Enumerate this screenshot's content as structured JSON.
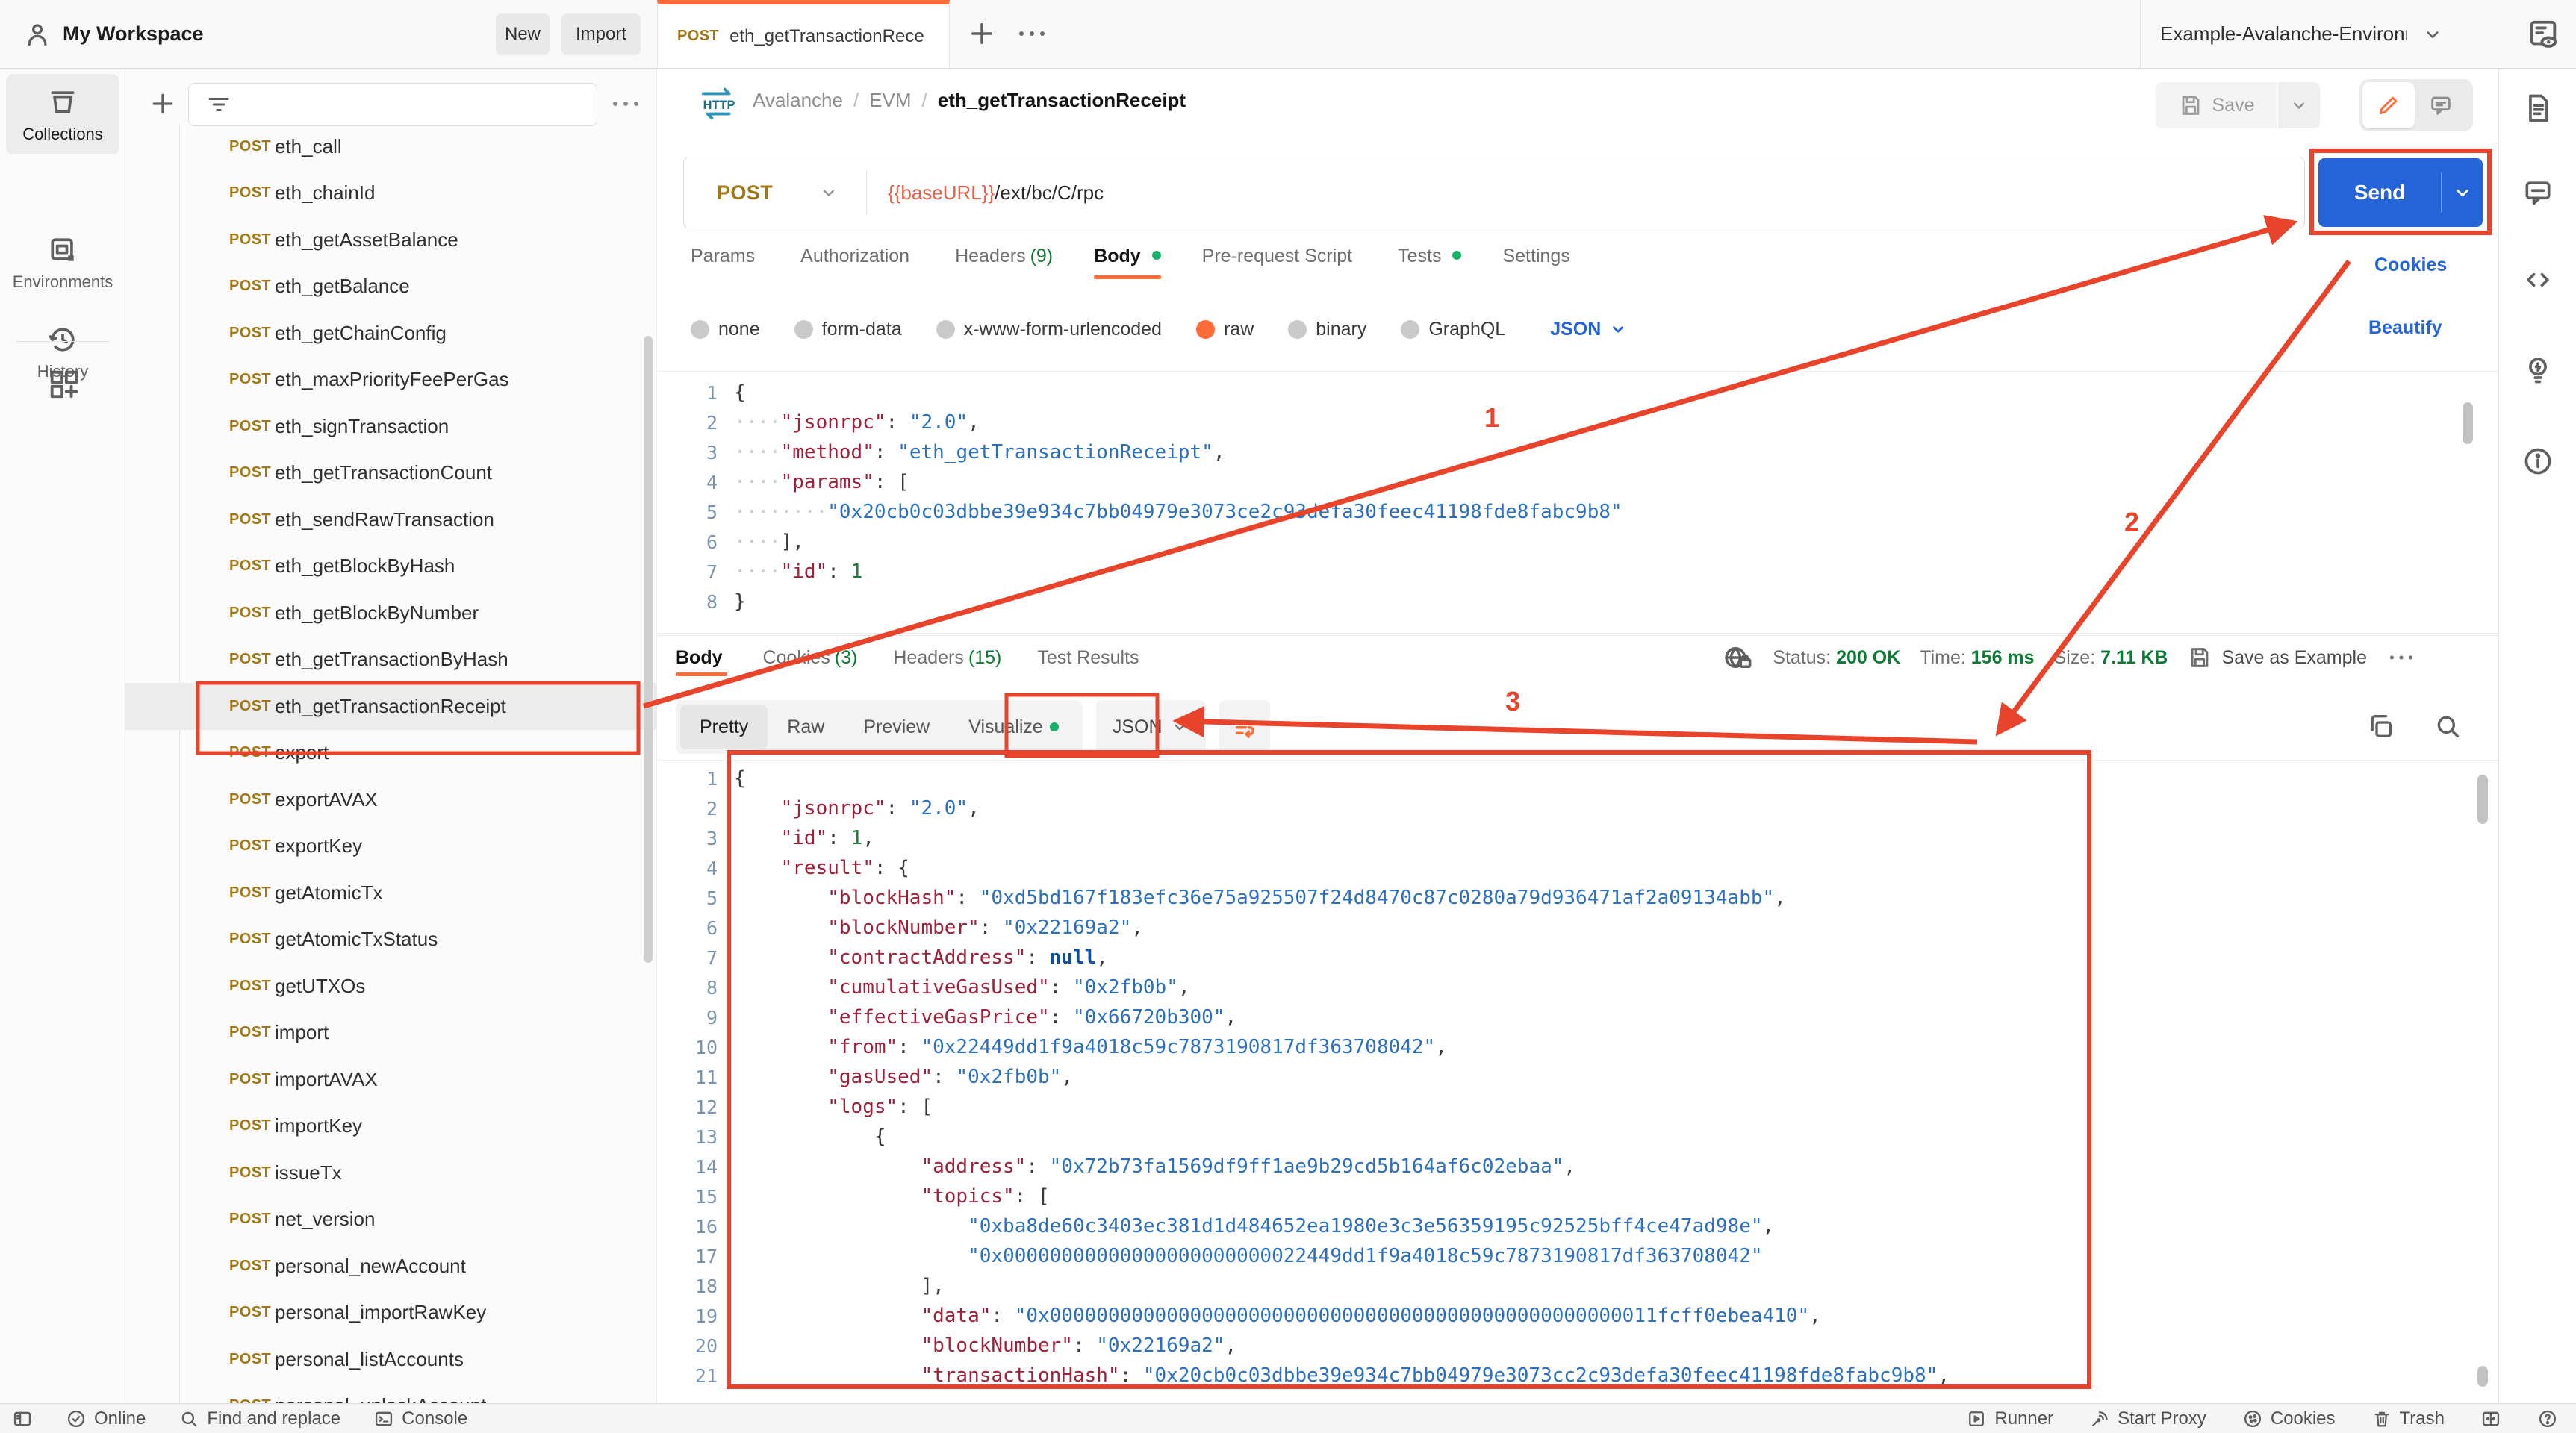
{
  "colors": {
    "accent_orange": "#FF6C37",
    "primary_blue": "#2563D9",
    "success_green": "#0E7B34",
    "annotation_red": "#E8442C",
    "post_badge": "#A07617"
  },
  "header": {
    "workspace_title": "My Workspace",
    "new_label": "New",
    "import_label": "Import",
    "tab": {
      "method": "POST",
      "title": "eth_getTransactionRece"
    },
    "environment": "Example-Avalanche-Environme"
  },
  "icon_rail": {
    "collections": "Collections",
    "environments": "Environments",
    "history": "History"
  },
  "sidebar": {
    "requests": [
      {
        "method": "POST",
        "name": "eth_call"
      },
      {
        "method": "POST",
        "name": "eth_chainId"
      },
      {
        "method": "POST",
        "name": "eth_getAssetBalance"
      },
      {
        "method": "POST",
        "name": "eth_getBalance"
      },
      {
        "method": "POST",
        "name": "eth_getChainConfig"
      },
      {
        "method": "POST",
        "name": "eth_maxPriorityFeePerGas"
      },
      {
        "method": "POST",
        "name": "eth_signTransaction"
      },
      {
        "method": "POST",
        "name": "eth_getTransactionCount"
      },
      {
        "method": "POST",
        "name": "eth_sendRawTransaction"
      },
      {
        "method": "POST",
        "name": "eth_getBlockByHash"
      },
      {
        "method": "POST",
        "name": "eth_getBlockByNumber"
      },
      {
        "method": "POST",
        "name": "eth_getTransactionByHash"
      },
      {
        "method": "POST",
        "name": "eth_getTransactionReceipt"
      },
      {
        "method": "POST",
        "name": "export"
      },
      {
        "method": "POST",
        "name": "exportAVAX"
      },
      {
        "method": "POST",
        "name": "exportKey"
      },
      {
        "method": "POST",
        "name": "getAtomicTx"
      },
      {
        "method": "POST",
        "name": "getAtomicTxStatus"
      },
      {
        "method": "POST",
        "name": "getUTXOs"
      },
      {
        "method": "POST",
        "name": "import"
      },
      {
        "method": "POST",
        "name": "importAVAX"
      },
      {
        "method": "POST",
        "name": "importKey"
      },
      {
        "method": "POST",
        "name": "issueTx"
      },
      {
        "method": "POST",
        "name": "net_version"
      },
      {
        "method": "POST",
        "name": "personal_newAccount"
      },
      {
        "method": "POST",
        "name": "personal_importRawKey"
      },
      {
        "method": "POST",
        "name": "personal_listAccounts"
      },
      {
        "method": "POST",
        "name": "personal_unlockAccount"
      }
    ]
  },
  "request": {
    "breadcrumb": {
      "part1": "Avalanche",
      "part2": "EVM",
      "sep": "/",
      "current": "eth_getTransactionReceipt",
      "protocol": "HTTP"
    },
    "save_label": "Save",
    "method": "POST",
    "url_var": "{{baseURL}}",
    "url_path": "/ext/bc/C/rpc",
    "send_label": "Send",
    "tabs": [
      {
        "label": "Params"
      },
      {
        "label": "Authorization"
      },
      {
        "label": "Headers",
        "count": "(9)"
      },
      {
        "label": "Body",
        "active": true,
        "dot": true
      },
      {
        "label": "Pre-request Script"
      },
      {
        "label": "Tests",
        "dot": true
      },
      {
        "label": "Settings"
      }
    ],
    "cookies_link": "Cookies",
    "beautify_link": "Beautify",
    "body_modes": [
      {
        "label": "none"
      },
      {
        "label": "form-data"
      },
      {
        "label": "x-www-form-urlencoded"
      },
      {
        "label": "raw",
        "selected": true
      },
      {
        "label": "binary"
      },
      {
        "label": "GraphQL"
      }
    ],
    "language": "JSON",
    "body_lines": [
      "{",
      "    \"jsonrpc\": \"2.0\",",
      "    \"method\": \"eth_getTransactionReceipt\",",
      "    \"params\": [",
      "        \"0x20cb0c03dbbe39e934c7bb04979e3073ce2c93defa30feec41198fde8fabc9b8\"",
      "    ],",
      "    \"id\": 1",
      "}"
    ]
  },
  "response": {
    "tabs": [
      {
        "label": "Body",
        "active": true
      },
      {
        "label": "Cookies",
        "count": "(3)"
      },
      {
        "label": "Headers",
        "count": "(15)"
      },
      {
        "label": "Test Results"
      }
    ],
    "status_label": "Status:",
    "status_value": "200 OK",
    "time_label": "Time:",
    "time_value": "156 ms",
    "size_label": "Size:",
    "size_value": "7.11 KB",
    "save_as_example": "Save as Example",
    "views": [
      {
        "label": "Pretty",
        "active": true
      },
      {
        "label": "Raw"
      },
      {
        "label": "Preview"
      },
      {
        "label": "Visualize",
        "dot": true
      }
    ],
    "language": "JSON",
    "body_lines": [
      "{",
      "    \"jsonrpc\": \"2.0\",",
      "    \"id\": 1,",
      "    \"result\": {",
      "        \"blockHash\": \"0xd5bd167f183efc36e75a925507f24d8470c87c0280a79d936471af2a09134abb\",",
      "        \"blockNumber\": \"0x22169a2\",",
      "        \"contractAddress\": null,",
      "        \"cumulativeGasUsed\": \"0x2fb0b\",",
      "        \"effectiveGasPrice\": \"0x66720b300\",",
      "        \"from\": \"0x22449dd1f9a4018c59c7873190817df363708042\",",
      "        \"gasUsed\": \"0x2fb0b\",",
      "        \"logs\": [",
      "            {",
      "                \"address\": \"0x72b73fa1569df9ff1ae9b29cd5b164af6c02ebaa\",",
      "                \"topics\": [",
      "                    \"0xba8de60c3403ec381d1d484652ea1980e3c3e56359195c92525bff4ce47ad98e\",",
      "                    \"0x00000000000000000000000022449dd1f9a4018c59c7873190817df363708042\"",
      "                ],",
      "                \"data\": \"0x0000000000000000000000000000000000000000000000000011fcff0ebea410\",",
      "                \"blockNumber\": \"0x22169a2\",",
      "                \"transactionHash\": \"0x20cb0c03dbbe39e934c7bb04979e3073cc2c93defa30feec41198fde8fabc9b8\","
    ]
  },
  "status_bar": {
    "online": "Online",
    "find": "Find and replace",
    "console": "Console",
    "runner": "Runner",
    "proxy": "Start Proxy",
    "cookies": "Cookies",
    "trash": "Trash"
  },
  "annotations": {
    "one": "1",
    "two": "2",
    "three": "3"
  }
}
